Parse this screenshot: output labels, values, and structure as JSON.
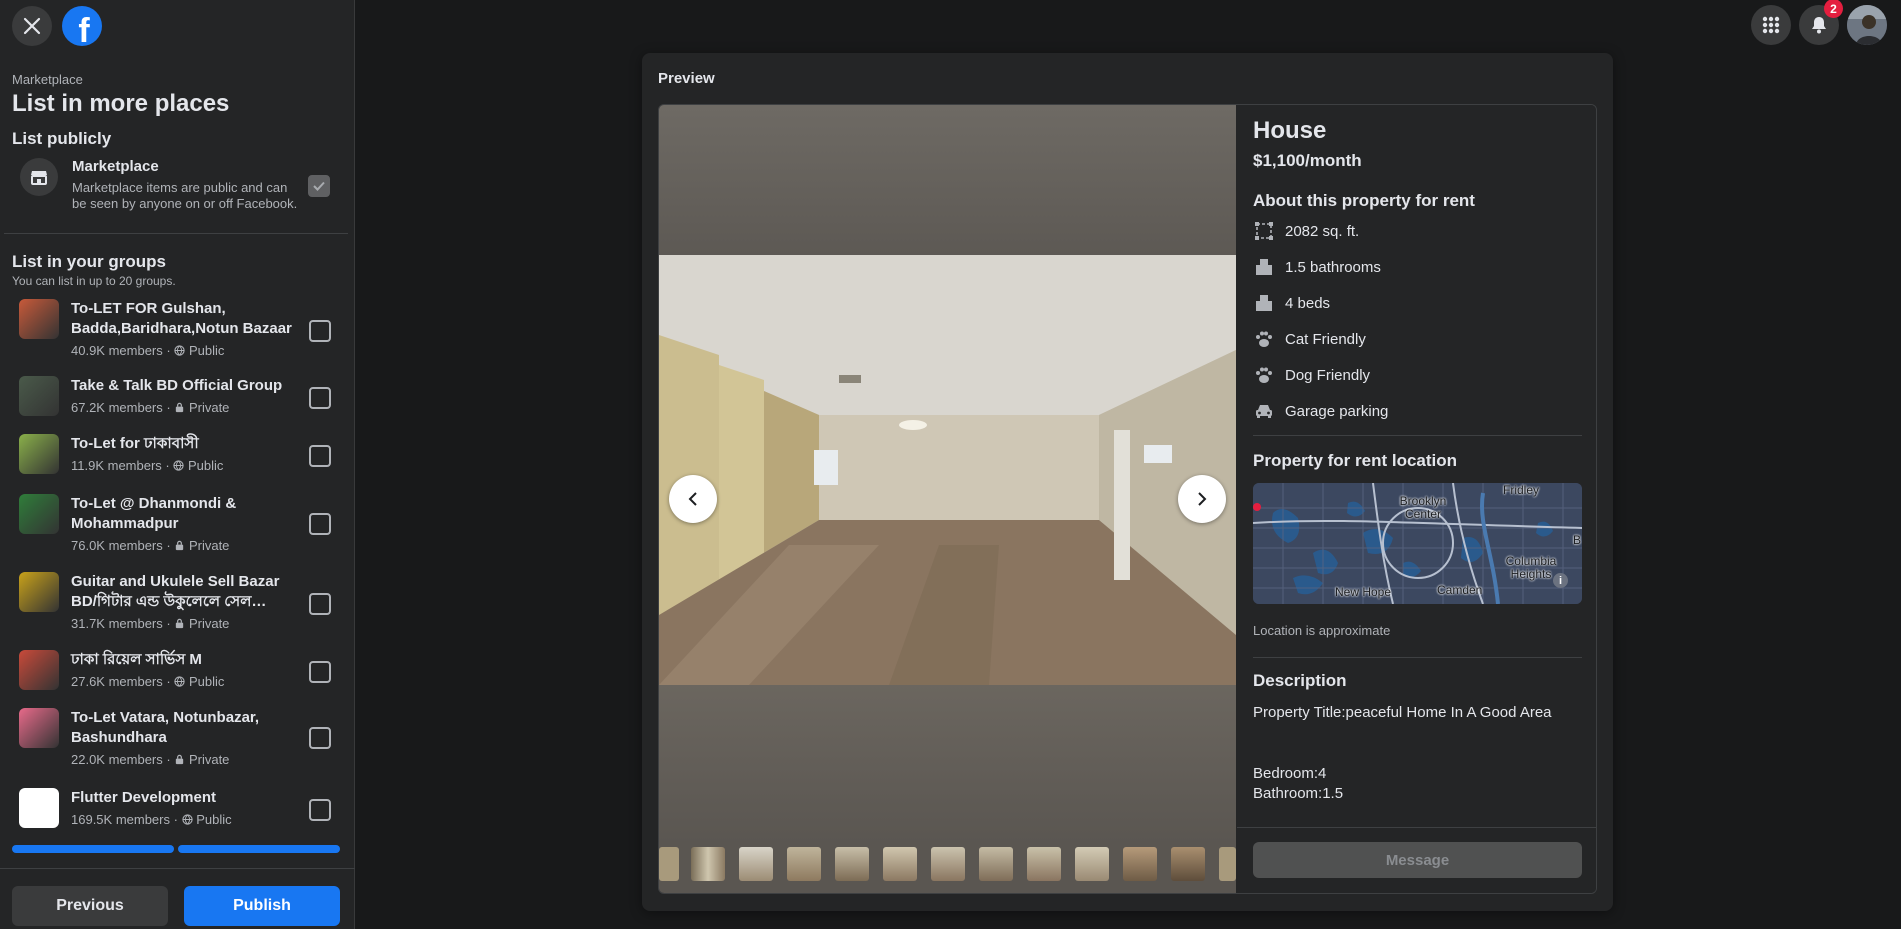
{
  "header": {
    "close_icon": "close-icon",
    "logo": "f",
    "notification_count": "2"
  },
  "sidebar": {
    "breadcrumb": "Marketplace",
    "title": "List in more places",
    "list_publicly": "List publicly",
    "marketplace": {
      "title": "Marketplace",
      "description": "Marketplace items are public and can be seen by anyone on or off Facebook.",
      "checked": true
    },
    "groups_heading": "List in your groups",
    "groups_subtitle": "You can list in up to 20 groups.",
    "groups": [
      {
        "name": "To-LET FOR Gulshan, Badda,Baridhara,Notun Bazaar",
        "members": "40.9K members",
        "privacy": "Public",
        "thumb_color": "#c85a3a"
      },
      {
        "name": "Take & Talk BD Official Group",
        "members": "67.2K members",
        "privacy": "Private",
        "thumb_color": "#4a5a4a"
      },
      {
        "name": "To-Let for ঢাকাবাসী",
        "members": "11.9K members",
        "privacy": "Public",
        "thumb_color": "#8ab04a"
      },
      {
        "name": "To-Let @ Dhanmondi & Mohammadpur",
        "members": "76.0K members",
        "privacy": "Private",
        "thumb_color": "#2f7d3a"
      },
      {
        "name": "Guitar and Ukulele Sell Bazar BD/গিটার এন্ড উকুলেলে সেল…",
        "members": "31.7K members",
        "privacy": "Private",
        "thumb_color": "#c9a21a"
      },
      {
        "name": "ঢাকা রিয়েল সার্ভিস M",
        "members": "27.6K members",
        "privacy": "Public",
        "thumb_color": "#c94a3a"
      },
      {
        "name": "To-Let Vatara, Notunbazar, Bashundhara",
        "members": "22.0K members",
        "privacy": "Private",
        "thumb_color": "#e86a8a"
      },
      {
        "name": "Flutter Development",
        "members": "169.5K members",
        "privacy": "Public",
        "thumb_color": "#ffffff"
      }
    ],
    "previous_label": "Previous",
    "publish_label": "Publish"
  },
  "preview": {
    "label": "Preview",
    "listing": {
      "title": "House",
      "price": "$1,100/month",
      "about_heading": "About this property for rent",
      "attributes": [
        {
          "icon": "area-icon",
          "text": "2082 sq. ft."
        },
        {
          "icon": "bathroom-icon",
          "text": "1.5 bathrooms"
        },
        {
          "icon": "bed-icon",
          "text": "4 beds"
        },
        {
          "icon": "paw-icon",
          "text": "Cat Friendly"
        },
        {
          "icon": "paw-icon",
          "text": "Dog Friendly"
        },
        {
          "icon": "car-icon",
          "text": "Garage parking"
        }
      ],
      "location_heading": "Property for rent location",
      "map_labels": [
        "Brooklyn Center",
        "Fridley",
        "Columbia Heights",
        "New Hope",
        "Camden",
        "B"
      ],
      "location_note": "Location is approximate",
      "description_heading": "Description",
      "description_title": "Property Title:peaceful Home In A Good Area",
      "description_bedroom": "Bedroom:4",
      "description_bathroom": "Bathroom:1.5",
      "message_label": "Message"
    }
  }
}
